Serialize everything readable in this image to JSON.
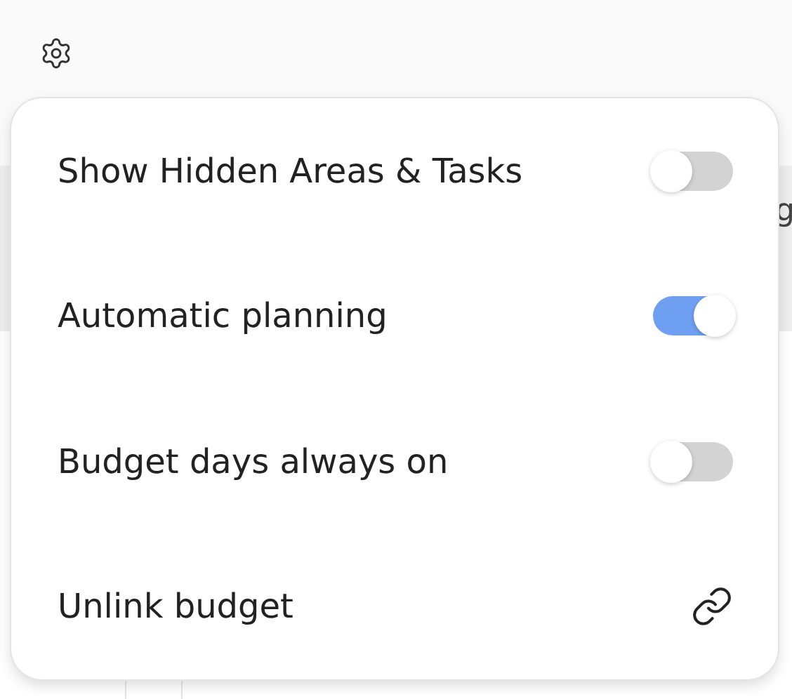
{
  "toolbar": {
    "settings_open": true
  },
  "background": {
    "column_text": "g"
  },
  "menu": {
    "items": [
      {
        "kind": "toggle",
        "label": "Show Hidden Areas & Tasks",
        "on": false
      },
      {
        "kind": "toggle",
        "label": "Automatic planning",
        "on": true
      },
      {
        "kind": "toggle",
        "label": "Budget days always on",
        "on": false
      },
      {
        "kind": "link",
        "label": "Unlink budget"
      }
    ]
  }
}
